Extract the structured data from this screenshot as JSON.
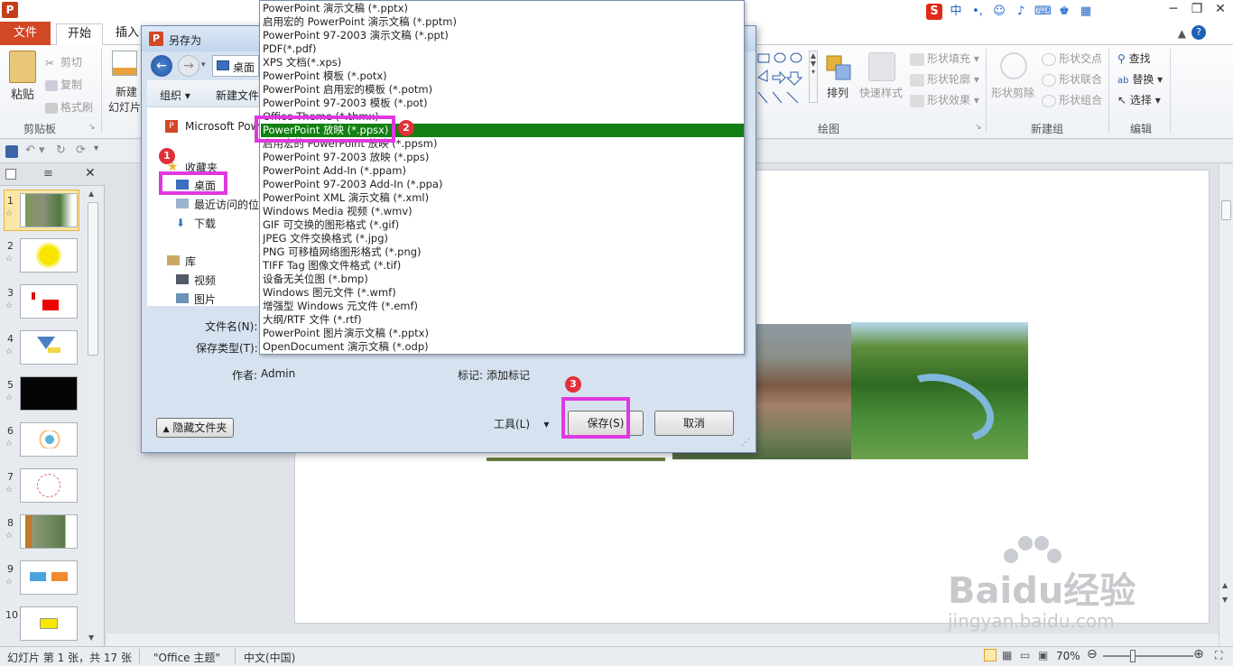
{
  "app": {
    "logo_text": "P",
    "tabs": [
      "文件",
      "开始",
      "插入"
    ]
  },
  "ribbon": {
    "clipboard": {
      "paste": "粘贴",
      "cut": "剪切",
      "copy": "复制",
      "format_painter": "格式刷",
      "label": "剪贴板"
    },
    "slides": {
      "new_slide_line1": "新建",
      "new_slide_line2": "幻灯片"
    },
    "drawing": {
      "shape_fill": "形状填充",
      "shape_outline": "形状轮廓",
      "shape_effects": "形状效果",
      "arrange": "排列",
      "quick_styles": "快速样式",
      "label": "绘图"
    },
    "new_group": {
      "shape_clip": "形状剪除",
      "shape_intersect": "形状交点",
      "shape_union": "形状联合",
      "shape_combine": "形状组合",
      "label": "新建组"
    },
    "editing": {
      "find": "查找",
      "replace": "替换",
      "select": "选择",
      "label": "编辑"
    }
  },
  "slides_pane": {
    "numbers": [
      "1",
      "2",
      "3",
      "4",
      "5",
      "6",
      "7",
      "8",
      "9",
      "10"
    ]
  },
  "dialog": {
    "title": "另存为",
    "location": "桌面",
    "organize": "组织",
    "new_folder": "新建文件夹",
    "microsoft": "Microsoft Pow",
    "nav": {
      "favorites": "收藏夹",
      "desktop": "桌面",
      "recent": "最近访问的位置",
      "downloads": "下载",
      "library": "库",
      "videos": "视频",
      "pictures": "图片"
    },
    "filename_label": "文件名(N):",
    "filetype_label": "保存类型(T):",
    "author_label": "作者:",
    "author_value": "Admin",
    "tag_label": "标记:",
    "tag_value": "添加标记",
    "hide_folders": "隐藏文件夹",
    "tools": "工具(L)",
    "save": "保存(S)",
    "cancel": "取消",
    "file_types": [
      "PowerPoint 演示文稿 (*.pptx)",
      "启用宏的 PowerPoint 演示文稿 (*.pptm)",
      "PowerPoint 97-2003 演示文稿 (*.ppt)",
      "PDF(*.pdf)",
      "XPS 文档(*.xps)",
      "PowerPoint 模板 (*.potx)",
      "PowerPoint 启用宏的模板 (*.potm)",
      "PowerPoint 97-2003 模板 (*.pot)",
      "Office Theme (*.thmx)",
      "PowerPoint 放映 (*.ppsx)",
      "启用宏的 PowerPoint 放映 (*.ppsm)",
      "PowerPoint 97-2003 放映 (*.pps)",
      "PowerPoint Add-In (*.ppam)",
      "PowerPoint 97-2003 Add-In (*.ppa)",
      "PowerPoint XML 演示文稿 (*.xml)",
      "Windows Media 视频 (*.wmv)",
      "GIF 可交换的图形格式 (*.gif)",
      "JPEG 文件交换格式 (*.jpg)",
      "PNG 可移植网络图形格式 (*.png)",
      "TIFF Tag 图像文件格式 (*.tif)",
      "设备无关位图 (*.bmp)",
      "Windows 图元文件 (*.wmf)",
      "增强型 Windows 元文件 (*.emf)",
      "大纲/RTF 文件 (*.rtf)",
      "PowerPoint 图片演示文稿 (*.pptx)",
      "OpenDocument 演示文稿 (*.odp)"
    ],
    "selected_index": 9
  },
  "badges": [
    "1",
    "2",
    "3"
  ],
  "status": {
    "slide_info": "幻灯片 第 1 张，共 17 张",
    "theme": "\"Office 主题\"",
    "language": "中文(中国)",
    "zoom": "70%"
  },
  "watermark": {
    "brand": "Baidu经验",
    "url": "jingyan.baidu.com"
  },
  "colors": {
    "file_tab": "#d24726",
    "selected_item": "#128012",
    "highlight": "#e038e0",
    "badge": "#e0303a"
  }
}
